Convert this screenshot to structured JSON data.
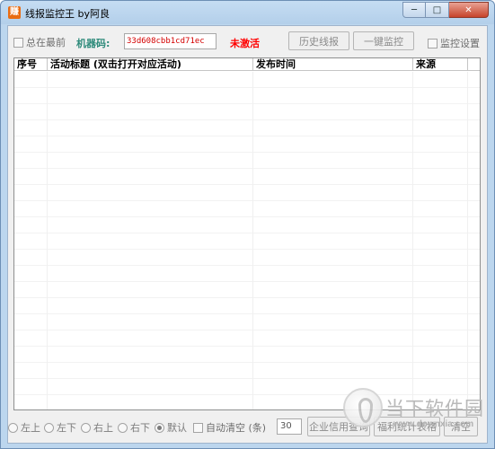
{
  "window": {
    "title": "线报监控王 by阿良",
    "icon_glyph": "赚",
    "minimize_glyph": "─",
    "maximize_glyph": "□",
    "close_glyph": "✕"
  },
  "toolbar": {
    "always_on_top_label": "总在最前",
    "machine_code_label": "机器码:",
    "machine_code_value": "33d608cbb1cd71ec",
    "activation_status": "未激活",
    "history_button": "历史线报",
    "monitor_button": "一键监控",
    "monitor_settings_label": "监控设置"
  },
  "list": {
    "columns": [
      "序号",
      "活动标题 (双击打开对应活动)",
      "发布时间",
      "来源"
    ],
    "rows": []
  },
  "bottom": {
    "position_options": [
      "左上",
      "左下",
      "右上",
      "右下",
      "默认"
    ],
    "selected_position": "默认",
    "auto_clear_label": "自动清空 (条)",
    "auto_clear_count": "30",
    "enterprise_button": "企业信用查询",
    "export_button": "福利统计表格",
    "clear_button": "清空"
  },
  "watermark": {
    "text": "当下软件园",
    "url": "www.downxia.com"
  },
  "colors": {
    "machine_label": "#2d8a7a",
    "machine_code": "#d40000",
    "status_red": "#ff0000",
    "window_frame": "#bcd6ee"
  }
}
